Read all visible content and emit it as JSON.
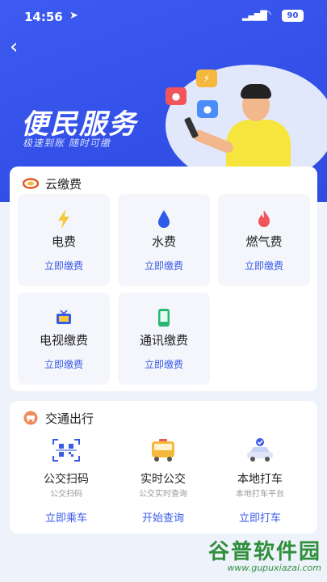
{
  "status_bar": {
    "time": "14:56",
    "battery": "90"
  },
  "hero": {
    "title": "便民服务",
    "subtitle": "极速到账  随时可缴"
  },
  "colors": {
    "brand": "#3350e8",
    "accent_link": "#3a5be8",
    "hero_person_shirt": "#f6e53c"
  },
  "cloud_pay": {
    "title": "云缴费",
    "items": [
      {
        "icon": "lightning-icon",
        "name": "电费",
        "action": "立即缴费"
      },
      {
        "icon": "water-drop-icon",
        "name": "水费",
        "action": "立即缴费"
      },
      {
        "icon": "flame-icon",
        "name": "燃气费",
        "action": "立即缴费"
      },
      {
        "icon": "tv-icon",
        "name": "电视缴费",
        "action": "立即缴费"
      },
      {
        "icon": "phone-icon",
        "name": "通讯缴费",
        "action": "立即缴费"
      }
    ]
  },
  "transport": {
    "title": "交通出行",
    "items": [
      {
        "icon": "qr-scan-icon",
        "name": "公交扫码",
        "sub": "公交扫码",
        "action": "立即乘车"
      },
      {
        "icon": "bus-icon",
        "name": "实时公交",
        "sub": "公交实时查询",
        "action": "开始查询"
      },
      {
        "icon": "taxi-icon",
        "name": "本地打车",
        "sub": "本地打车平台",
        "action": "立即打车"
      }
    ]
  },
  "watermark": {
    "title": "谷普软件园",
    "url": "www.gupuxiazai.com"
  }
}
